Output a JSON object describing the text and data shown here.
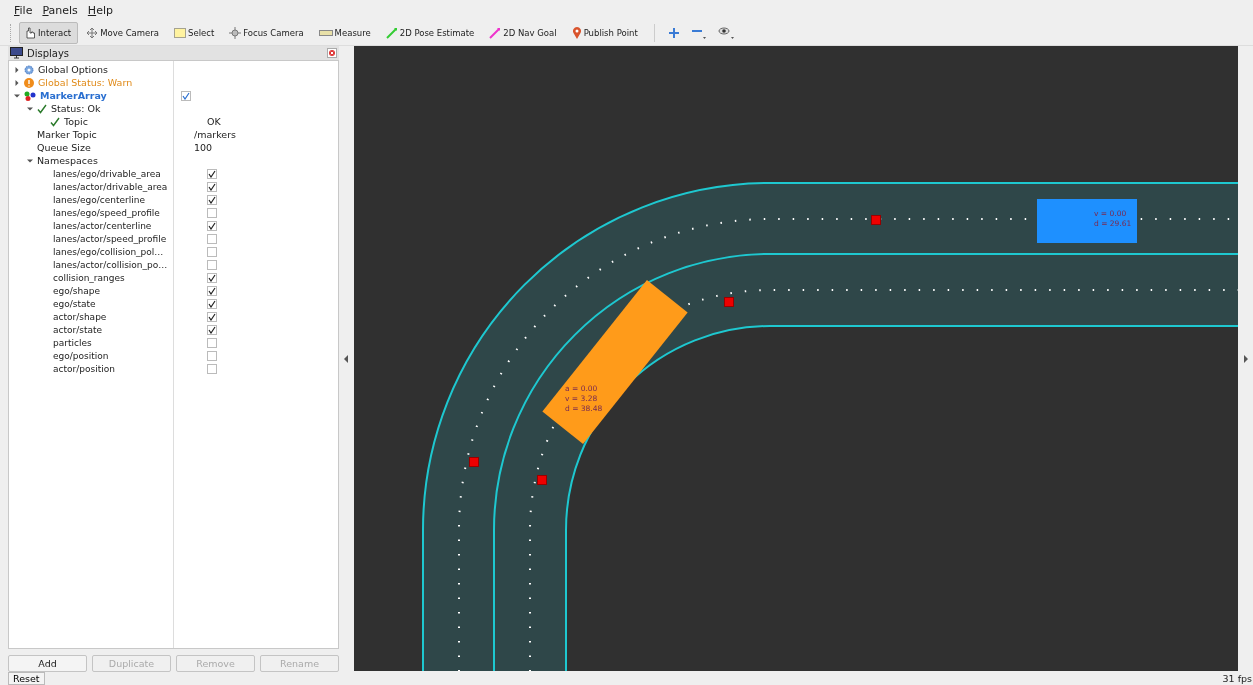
{
  "menu": [
    "File",
    "Panels",
    "Help"
  ],
  "toolbar": [
    {
      "label": "Interact",
      "kind": "interact",
      "selected": true
    },
    {
      "label": "Move Camera",
      "kind": "move",
      "selected": false
    },
    {
      "label": "Select",
      "kind": "select",
      "selected": false
    },
    {
      "label": "Focus Camera",
      "kind": "focus",
      "selected": false
    },
    {
      "label": "Measure",
      "kind": "measure",
      "selected": false
    },
    {
      "label": "2D Pose Estimate",
      "kind": "pose",
      "selected": false
    },
    {
      "label": "2D Nav Goal",
      "kind": "goal",
      "selected": false
    },
    {
      "label": "Publish Point",
      "kind": "point",
      "selected": false
    }
  ],
  "displays": {
    "title": "Displays",
    "tree": [
      {
        "label": "Global Options",
        "kind": "options",
        "expanded": false
      },
      {
        "label": "Global Status: Warn",
        "kind": "warn",
        "expanded": false
      },
      {
        "label": "MarkerArray",
        "kind": "display",
        "expanded": true,
        "checked": true,
        "children": [
          {
            "label": "Status: Ok",
            "kind": "ok",
            "expanded": true,
            "children": [
              {
                "label": "Topic",
                "kind": "ok",
                "value": "OK"
              }
            ]
          },
          {
            "label": "Marker Topic",
            "kind": "property",
            "value": "/markers"
          },
          {
            "label": "Queue Size",
            "kind": "property",
            "value": "100"
          },
          {
            "label": "Namespaces",
            "kind": "group",
            "expanded": true,
            "children": [
              {
                "label": "lanes/ego/drivable_area",
                "kind": "namespace",
                "checked": true
              },
              {
                "label": "lanes/actor/drivable_area",
                "kind": "namespace",
                "checked": true
              },
              {
                "label": "lanes/ego/centerline",
                "kind": "namespace",
                "checked": true
              },
              {
                "label": "lanes/ego/speed_profile",
                "kind": "namespace",
                "checked": false
              },
              {
                "label": "lanes/actor/centerline",
                "kind": "namespace",
                "checked": true
              },
              {
                "label": "lanes/actor/speed_profile",
                "kind": "namespace",
                "checked": false
              },
              {
                "label": "lanes/ego/collision_pol…",
                "kind": "namespace",
                "checked": false
              },
              {
                "label": "lanes/actor/collision_po…",
                "kind": "namespace",
                "checked": false
              },
              {
                "label": "collision_ranges",
                "kind": "namespace",
                "checked": true
              },
              {
                "label": "ego/shape",
                "kind": "namespace",
                "checked": true
              },
              {
                "label": "ego/state",
                "kind": "namespace",
                "checked": true
              },
              {
                "label": "actor/shape",
                "kind": "namespace",
                "checked": true
              },
              {
                "label": "actor/state",
                "kind": "namespace",
                "checked": true
              },
              {
                "label": "particles",
                "kind": "namespace",
                "checked": false
              },
              {
                "label": "ego/position",
                "kind": "namespace",
                "checked": false
              },
              {
                "label": "actor/position",
                "kind": "namespace",
                "checked": false
              }
            ]
          }
        ]
      }
    ],
    "buttons": [
      {
        "label": "Add",
        "disabled": false
      },
      {
        "label": "Duplicate",
        "disabled": true
      },
      {
        "label": "Remove",
        "disabled": true
      },
      {
        "label": "Rename",
        "disabled": true
      }
    ]
  },
  "scene": {
    "vehicles": [
      {
        "kind": "ego",
        "lines": [
          "a  =  0.00",
          "v  =  3.28",
          "d  =  38.48"
        ]
      },
      {
        "kind": "actor",
        "lines": [
          "v  =  0.00",
          "d  =  29.61"
        ]
      }
    ]
  },
  "status_bar": {
    "reset": "Reset",
    "fps": "31 fps"
  }
}
